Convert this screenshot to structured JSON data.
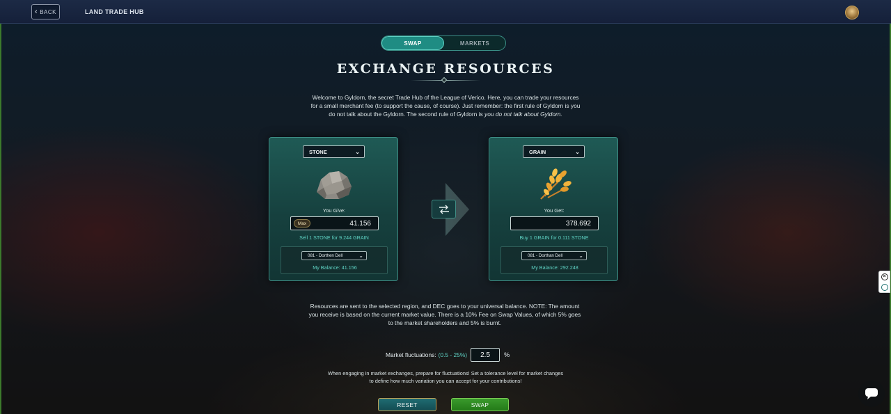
{
  "topbar": {
    "back_label": "BACK",
    "title": "LAND TRADE HUB"
  },
  "tabs": [
    {
      "label": "SWAP",
      "active": true
    },
    {
      "label": "MARKETS",
      "active": false
    }
  ],
  "heading": "EXCHANGE RESOURCES",
  "intro": {
    "text": "Welcome to Gyldorn, the secret Trade Hub of the League of Verico. Here, you can trade your resources for a small merchant fee (to support the cause, of course). Just remember: the first rule of Gyldorn is you do not talk about the Gyldorn. The second rule of Gyldorn is ",
    "emphasis": "you do not talk about Gyldorn."
  },
  "give_card": {
    "resource": "STONE",
    "label": "You Give:",
    "max_label": "Max",
    "amount": "41.156",
    "rate": "Sell 1 STONE for 9.244 GRAIN",
    "region": "081 - Dorthen Dell",
    "balance": "My Balance: 41.156"
  },
  "get_card": {
    "resource": "GRAIN",
    "label": "You Get:",
    "amount": "378.692",
    "rate": "Buy 1 GRAIN for 0.111 STONE",
    "region": "081 - Dorthan Dell",
    "balance": "My Balance: 292.248"
  },
  "note": "Resources are sent to the selected region, and DEC goes to your universal balance. NOTE: The amount you receive is based on the current market value. There is a 10% Fee on Swap Values, of which 5% goes to the market shareholders and 5% is burnt.",
  "fluctuation": {
    "label": "Market fluctuations:",
    "range": "(0.5 - 25%)",
    "value": "2.5",
    "unit": "%",
    "help": "When engaging in market exchanges, prepare for fluctuations! Set a tolerance level for market changes to define how much variation you can accept for your contributions!"
  },
  "buttons": {
    "reset": "RESET",
    "swap": "SWAP"
  },
  "colors": {
    "accent_teal": "#1f8c83",
    "highlight_text": "#5fd3c4",
    "swap_green": "#3a9a2c",
    "reset_border_gold": "#c0a357"
  },
  "icons": [
    "back-arrow-icon",
    "chevron-down-icon",
    "stone-icon",
    "grain-icon",
    "swap-arrows-icon",
    "chat-icon",
    "close-icon"
  ]
}
